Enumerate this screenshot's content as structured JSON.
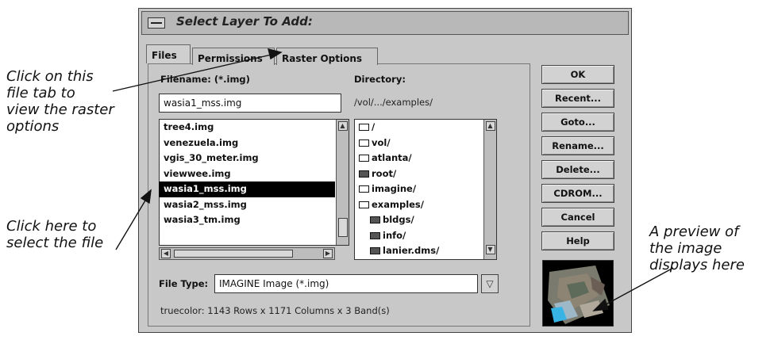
{
  "dialog": {
    "title": "Select Layer To Add:"
  },
  "tabs": [
    {
      "label": "Files"
    },
    {
      "label": "Permissions"
    },
    {
      "label": "Raster Options"
    }
  ],
  "filename": {
    "label": "Filename: (*.img)",
    "value": "wasia1_mss.img"
  },
  "directory": {
    "label": "Directory:",
    "path": "/vol/.../examples/"
  },
  "files": [
    {
      "name": "tree4.img"
    },
    {
      "name": "venezuela.img"
    },
    {
      "name": "vgis_30_meter.img"
    },
    {
      "name": "viewwee.img"
    },
    {
      "name": "wasia1_mss.img",
      "selected": true
    },
    {
      "name": "wasia2_mss.img"
    },
    {
      "name": "wasia3_tm.img"
    }
  ],
  "dirs": [
    {
      "name": "/"
    },
    {
      "name": "vol/"
    },
    {
      "name": "atlanta/"
    },
    {
      "name": "root/"
    },
    {
      "name": "imagine/"
    },
    {
      "name": "examples/"
    },
    {
      "name": "bldgs/"
    },
    {
      "name": "info/"
    },
    {
      "name": "lanier.dms/"
    }
  ],
  "filetype": {
    "label": "File Type:",
    "value": "IMAGINE Image (*.img)"
  },
  "status": "truecolor: 1143 Rows x 1171 Columns x 3 Band(s)",
  "buttons": {
    "ok": "OK",
    "recent": "Recent...",
    "goto": "Goto...",
    "rename": "Rename...",
    "delete": "Delete...",
    "cdrom": "CDROM...",
    "cancel": "Cancel",
    "help": "Help"
  },
  "annotations": {
    "tab_callout": [
      "Click on this",
      "file tab to",
      "view the raster",
      "options"
    ],
    "file_callout": [
      "Click here to",
      "select the file"
    ],
    "preview_callout": [
      "A preview of",
      "the image",
      "displays here"
    ]
  }
}
